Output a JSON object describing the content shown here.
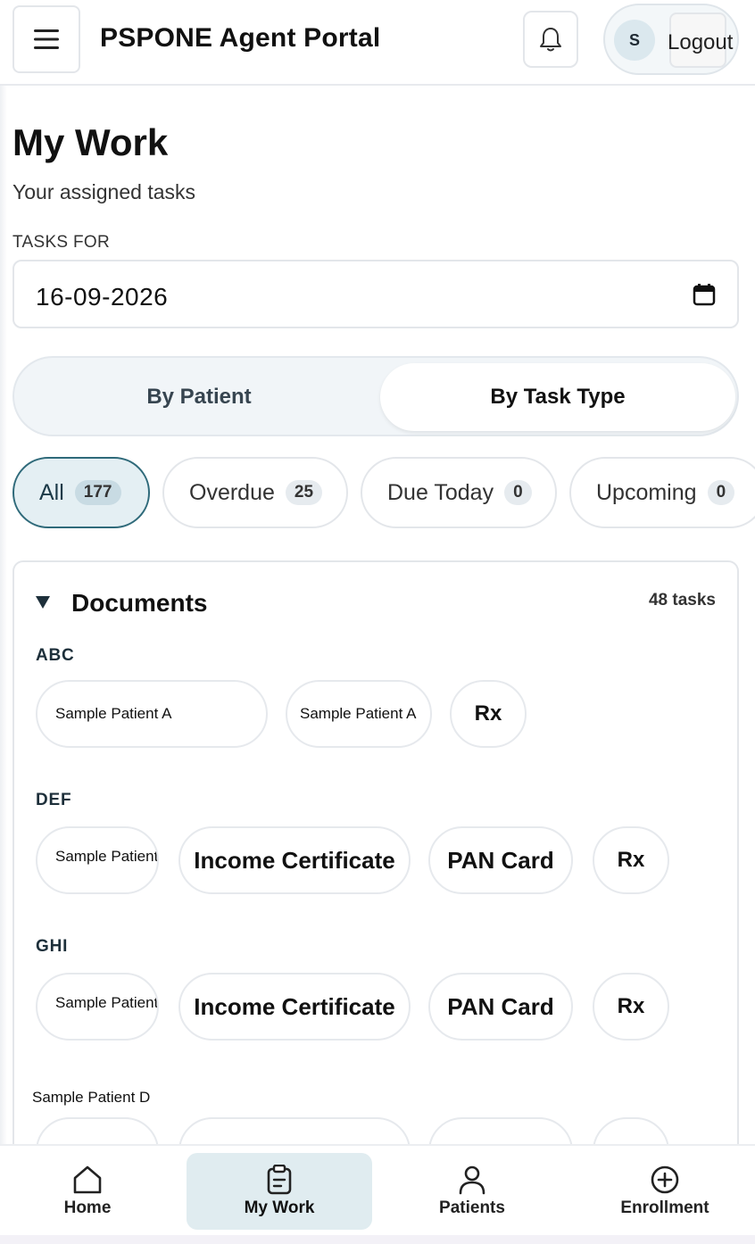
{
  "header": {
    "menu_icon": "hamburger-icon",
    "app_title": "PSPONE Agent Portal",
    "bell_icon": "bell-icon",
    "avatar_initial": "S",
    "logout_label": "Logout"
  },
  "page": {
    "title": "My Work",
    "subtitle": "Your assigned tasks",
    "tasks_for_label": "TASKS FOR",
    "date_value": "16-09-2026",
    "calendar_icon": "calendar-icon"
  },
  "view_toggle": {
    "by_patient": "By Patient",
    "by_task_type": "By Task Type",
    "selected": "by_task_type"
  },
  "filters": [
    {
      "label": "All",
      "count": "177",
      "active": true
    },
    {
      "label": "Overdue",
      "count": "25",
      "active": false
    },
    {
      "label": "Due Today",
      "count": "0",
      "active": false
    },
    {
      "label": "Upcoming",
      "count": "0",
      "active": false
    }
  ],
  "documents": {
    "title": "Documents",
    "count_label": "48 tasks",
    "expanded": true,
    "groups": [
      {
        "label": "ABC",
        "items": [
          "Sample Patient A",
          "Sample Patient A",
          "Rx"
        ]
      },
      {
        "label": "DEF",
        "items": [
          "Sample Patient B",
          "Income Certificate",
          "PAN Card",
          "Rx"
        ]
      },
      {
        "label": "GHI",
        "items": [
          "Sample Patient C",
          "Income Certificate",
          "PAN Card",
          "Rx"
        ]
      }
    ],
    "next_patient_label": "Sample Patient D"
  },
  "bottom_nav": [
    {
      "label": "Home",
      "icon": "home-icon",
      "active": false
    },
    {
      "label": "My Work",
      "icon": "clipboard-icon",
      "active": true
    },
    {
      "label": "Patients",
      "icon": "person-icon",
      "active": false
    },
    {
      "label": "Enrollment",
      "icon": "plus-circle-icon",
      "active": false
    }
  ]
}
